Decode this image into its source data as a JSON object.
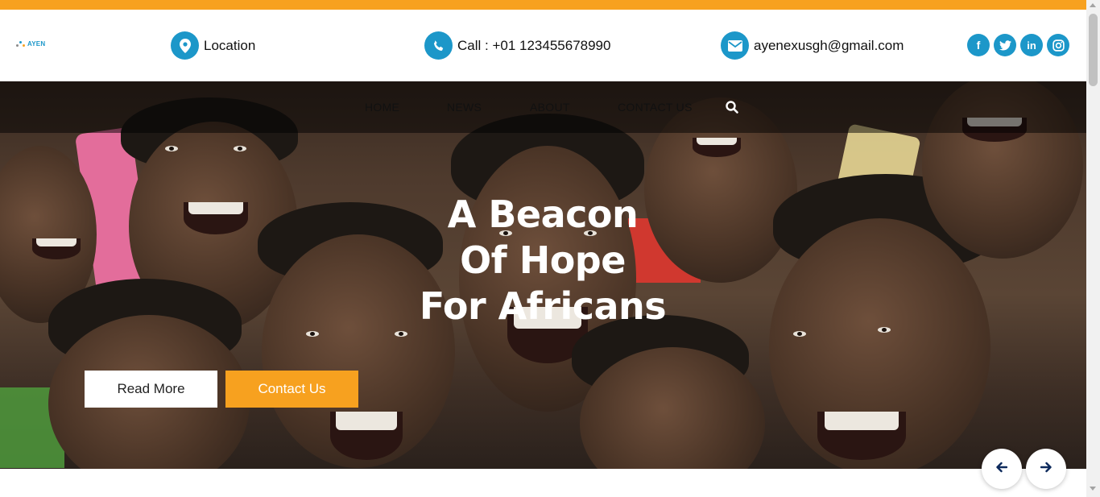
{
  "colors": {
    "accent_orange": "#f7a11f",
    "accent_blue": "#1c97c9",
    "white": "#ffffff"
  },
  "brand": {
    "logo_text": "AYEN"
  },
  "header": {
    "location_label": "Location",
    "call_label": "Call : +01 123455678990",
    "email_label": "ayenexusgh@gmail.com",
    "socials": [
      {
        "name": "facebook",
        "glyph": "f"
      },
      {
        "name": "twitter",
        "glyph": "t"
      },
      {
        "name": "linkedin",
        "glyph": "in"
      },
      {
        "name": "instagram",
        "glyph": "ig"
      }
    ]
  },
  "nav": {
    "items": [
      {
        "label": "HOME"
      },
      {
        "label": "NEWS"
      },
      {
        "label": "ABOUT"
      },
      {
        "label": "CONTACT US"
      }
    ]
  },
  "hero": {
    "title_lines": [
      "A Beacon",
      "Of Hope",
      "For Africans"
    ],
    "read_more_label": "Read More",
    "contact_label": "Contact Us"
  },
  "icons": {
    "location": "map-marker-icon",
    "phone": "phone-icon",
    "email": "envelope-icon",
    "search": "search-icon",
    "prev": "arrow-left-icon",
    "next": "arrow-right-icon"
  }
}
